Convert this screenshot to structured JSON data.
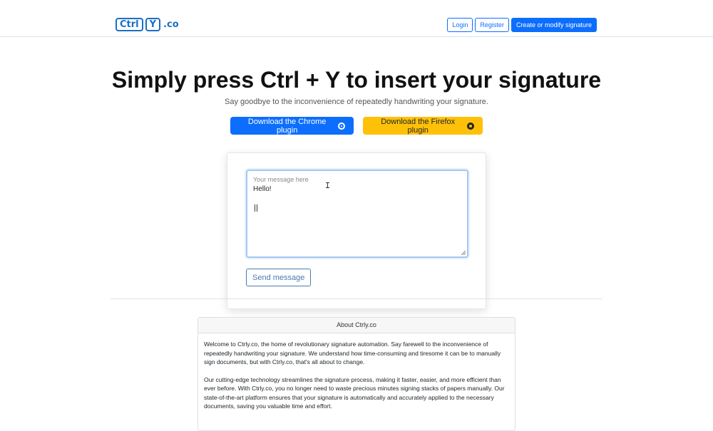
{
  "logo": {
    "key1": "Ctrl",
    "key2": "Y",
    "suffix": ".co"
  },
  "nav": {
    "login": "Login",
    "register": "Register",
    "create": "Create or modify signature"
  },
  "hero": {
    "title": "Simply press Ctrl + Y to insert your signature",
    "subtitle": "Say goodbye to the inconvenience of repeatedly handwriting your signature."
  },
  "downloads": {
    "chrome_label": "Download the Chrome plugin",
    "chrome_icon": "chrome-icon",
    "firefox_label": "Download the Firefox plugin",
    "firefox_icon": "firefox-icon"
  },
  "message": {
    "label": "Your message here",
    "value": "Hello!",
    "send_label": "Send message"
  },
  "about": {
    "title": "About Ctrly.co",
    "paragraphs": [
      "Welcome to Ctrly.co, the home of revolutionary signature automation. Say farewell to the inconvenience of repeatedly handwriting your signature. We understand how time-consuming and tiresome it can be to manually sign documents, but with Ctrly.co, that's all about to change.",
      "Our cutting-edge technology streamlines the signature process, making it faster, easier, and more efficient than ever before. With Ctrly.co, you no longer need to waste precious minutes signing stacks of papers manually. Our state-of-the-art platform ensures that your signature is automatically and accurately applied to the necessary documents, saving you valuable time and effort."
    ]
  },
  "colors": {
    "primary": "#0d6efd",
    "warning": "#ffc107",
    "brand": "#1a6fc4"
  }
}
